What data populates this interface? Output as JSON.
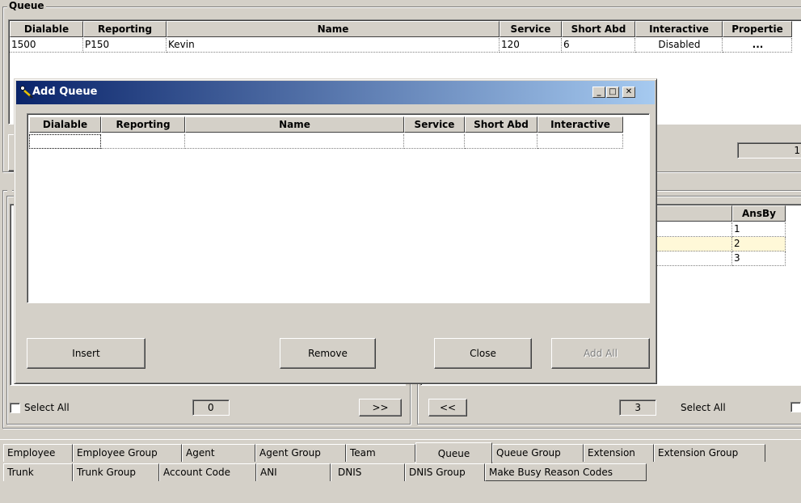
{
  "queue_group": {
    "label": "Queue",
    "columns": [
      "Dialable",
      "Reporting",
      "Name",
      "Service",
      "Short Abd",
      "Interactive",
      "Propertie"
    ],
    "rows": [
      {
        "dialable": "1500",
        "reporting": "P150",
        "name": "Kevin",
        "service": "120",
        "short_abd": "6",
        "interactive": "Disabled",
        "properties": "..."
      }
    ],
    "count_value": "1"
  },
  "lower_left": {
    "select_all": "Select All",
    "count": "0",
    "move_right": ">>"
  },
  "lower_right": {
    "column_ansby": "AnsBy",
    "ansby_values": [
      "1",
      "2",
      "3"
    ],
    "move_left": "<<",
    "count": "3",
    "select_all": "Select All"
  },
  "dialog": {
    "title": "Add Queue",
    "columns": [
      "Dialable",
      "Reporting",
      "Name",
      "Service",
      "Short Abd",
      "Interactive"
    ],
    "buttons": {
      "insert": "Insert",
      "remove": "Remove",
      "close": "Close",
      "add_all": "Add All"
    }
  },
  "tabs_row1": [
    "Employee",
    "Employee Group",
    "Agent",
    "Agent Group",
    "Team",
    "Queue",
    "Queue Group",
    "Extension",
    "Extension Group"
  ],
  "tabs_row2": [
    "Trunk",
    "Trunk Group",
    "Account Code",
    "ANI",
    "DNIS",
    "DNIS Group",
    "Make Busy Reason Codes"
  ],
  "active_tab": "Queue",
  "colors": {
    "title_gradient_start": "#0a246a",
    "title_gradient_end": "#a6caf0",
    "selected_row": "#fff8d8",
    "face": "#d4d0c8"
  }
}
